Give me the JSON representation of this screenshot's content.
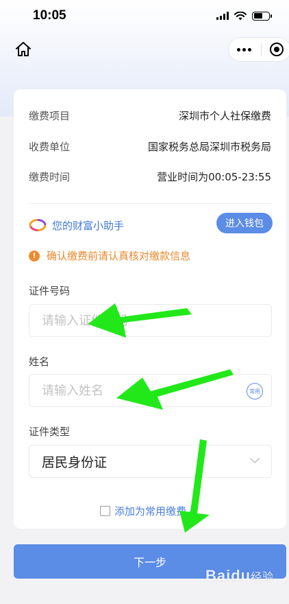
{
  "status_bar": {
    "time": "10:05"
  },
  "payment_info": [
    {
      "label": "缴费项目",
      "value": "深圳市个人社保缴费"
    },
    {
      "label": "收费单位",
      "value": "国家税务总局深圳市税务局"
    },
    {
      "label": "缴费时间",
      "value": "营业时间为00:05-23:55"
    }
  ],
  "assistant": {
    "label": "您的财富小助手",
    "wallet_button": "进入钱包"
  },
  "notice": {
    "icon_text": "!",
    "text": "确认缴费前请认真核对缴款信息"
  },
  "form": {
    "id_number": {
      "label": "证件号码",
      "placeholder": "请输入证件号码",
      "value": ""
    },
    "name": {
      "label": "姓名",
      "placeholder": "请输入姓名",
      "value": "",
      "badge": "常用"
    },
    "id_type": {
      "label": "证件类型",
      "value": "居民身份证"
    }
  },
  "add_common": {
    "label": "添加为常用缴费人",
    "checked": false
  },
  "next_button": "下一步",
  "watermark": {
    "brand": "Baidu",
    "sub": "经验"
  },
  "colors": {
    "accent": "#5b8ce6",
    "warning": "#f08a2c",
    "annotation_arrow": "#22e81a"
  }
}
